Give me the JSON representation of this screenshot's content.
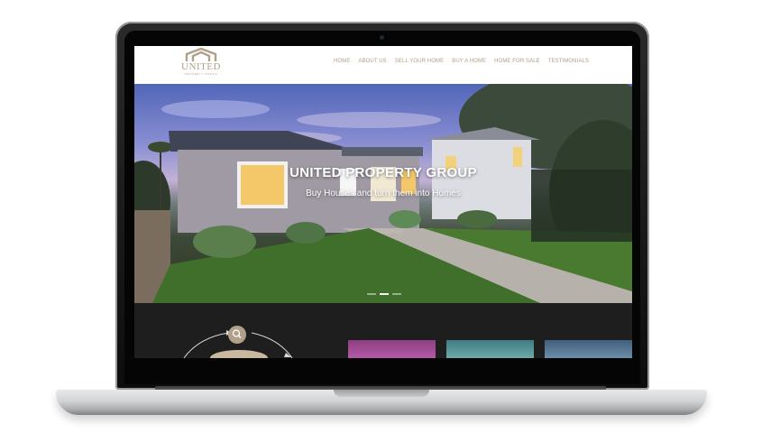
{
  "header": {
    "logo": {
      "name": "UNITED",
      "tagline": "PROPERTY GROUP"
    },
    "nav": [
      {
        "label": "HOME"
      },
      {
        "label": "ABOUT US"
      },
      {
        "label": "SELL YOUR HOME"
      },
      {
        "label": "BUY A HOME"
      },
      {
        "label": "HOME FOR SALE"
      },
      {
        "label": "TESTIMONIALS"
      }
    ]
  },
  "hero": {
    "title": "UNITED PROPERTY GROUP",
    "subtitle": "Buy Houses and turn them into Homes",
    "slides_total": 3,
    "active_slide": 2
  },
  "colors": {
    "brand": "#b1a089",
    "dark_section": "#1e1e1e"
  },
  "icons": [
    "house-logo-icon",
    "search-icon"
  ]
}
